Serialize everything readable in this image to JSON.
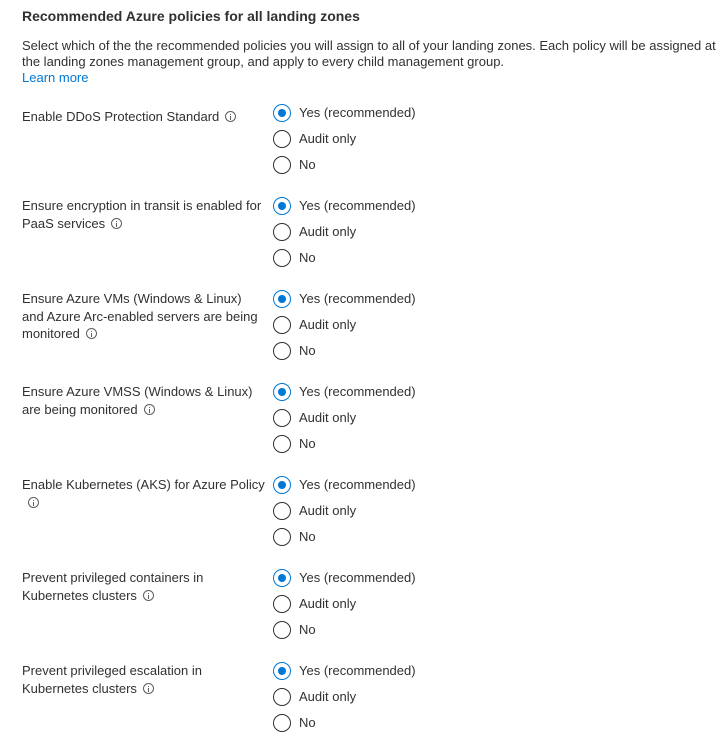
{
  "section": {
    "title": "Recommended Azure policies for all landing zones",
    "description": "Select which of the the recommended policies you will assign to all of your landing zones. Each policy will be assigned at the landing zones management group, and apply to every child management group.",
    "learn_more": "Learn more"
  },
  "options": {
    "yes": "Yes (recommended)",
    "audit": "Audit only",
    "no": "No"
  },
  "policies": [
    {
      "label": "Enable DDoS Protection Standard",
      "selected": "yes"
    },
    {
      "label": "Ensure encryption in transit is enabled for PaaS services",
      "selected": "yes"
    },
    {
      "label": "Ensure Azure VMs (Windows & Linux) and Azure Arc-enabled servers are being monitored",
      "selected": "yes"
    },
    {
      "label": "Ensure Azure VMSS (Windows & Linux) are being monitored",
      "selected": "yes"
    },
    {
      "label": "Enable Kubernetes (AKS) for Azure Policy",
      "selected": "yes"
    },
    {
      "label": "Prevent privileged containers in Kubernetes clusters",
      "selected": "yes"
    },
    {
      "label": "Prevent privileged escalation in Kubernetes clusters",
      "selected": "yes"
    }
  ],
  "colors": {
    "accent": "#0078d4",
    "text": "#323130"
  },
  "icons": {
    "info": "info-icon",
    "radio_selected": "radio-selected-icon",
    "radio_unselected": "radio-unselected-icon"
  }
}
